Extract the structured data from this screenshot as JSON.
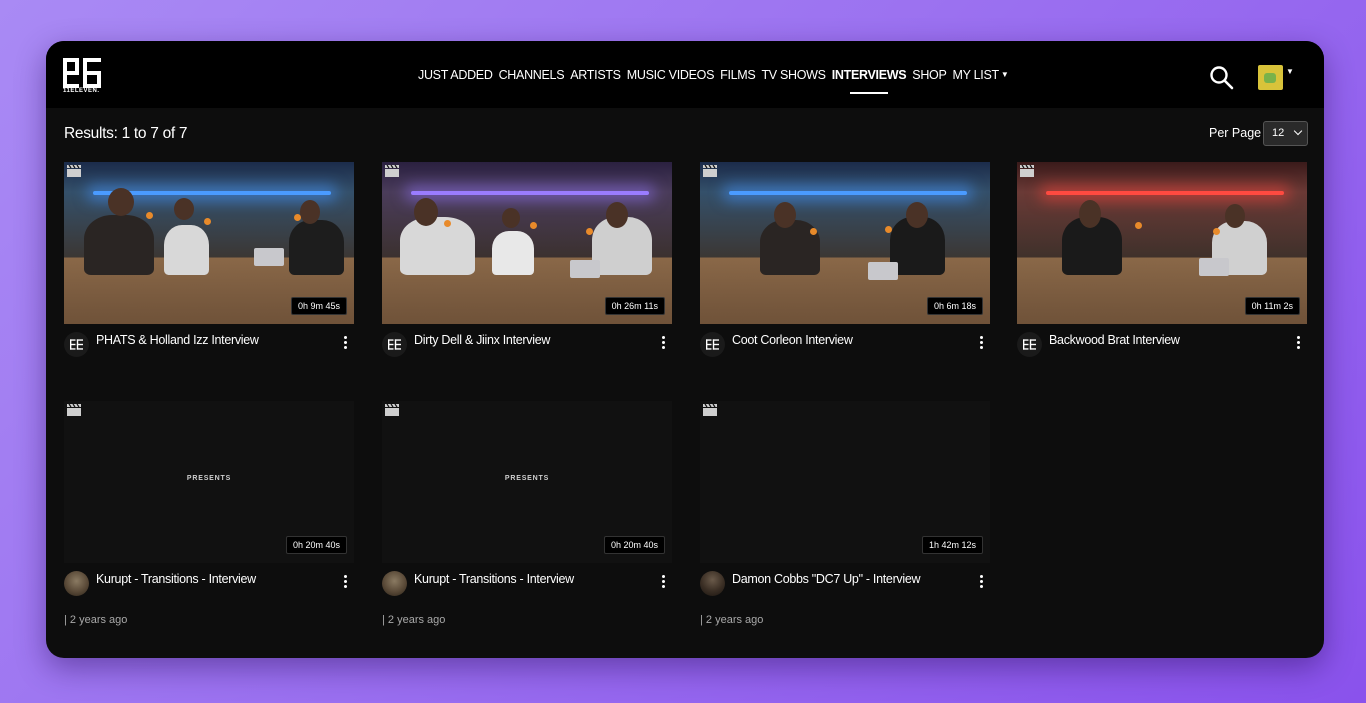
{
  "brand": {
    "logo_text": "11ELEVEN."
  },
  "nav": {
    "items": [
      {
        "label": "JUST ADDED"
      },
      {
        "label": "CHANNELS"
      },
      {
        "label": "ARTISTS"
      },
      {
        "label": "MUSIC VIDEOS"
      },
      {
        "label": "FILMS"
      },
      {
        "label": "TV SHOWS"
      },
      {
        "label": "INTERVIEWS",
        "active": true
      },
      {
        "label": "SHOP"
      },
      {
        "label": "MY LIST"
      }
    ]
  },
  "header_icons": {
    "search": "search-icon",
    "avatar": "avatar-icon"
  },
  "results": {
    "text": "Results: 1 to 7 of 7"
  },
  "per_page": {
    "label": "Per Page",
    "value": "12"
  },
  "videos": [
    {
      "title": "PHATS & Holland Izz Interview",
      "duration": "0h 9m 45s",
      "meta": ""
    },
    {
      "title": "Dirty Dell & Jiinx Interview",
      "duration": "0h 26m 11s",
      "meta": ""
    },
    {
      "title": "Coot Corleon Interview",
      "duration": "0h 6m 18s",
      "meta": ""
    },
    {
      "title": "Backwood Brat Interview",
      "duration": "0h 11m 2s",
      "meta": ""
    },
    {
      "title": "Kurupt - Transitions - Interview",
      "duration": "0h 20m 40s",
      "overlay": "PRESENTS",
      "meta": "| 2 years ago"
    },
    {
      "title": "Kurupt - Transitions - Interview",
      "duration": "0h 20m 40s",
      "overlay": "PRESENTS",
      "meta": "| 2 years ago"
    },
    {
      "title": "Damon Cobbs \"DC7 Up\" - Interview",
      "duration": "1h 42m 12s",
      "meta": "| 2 years ago"
    }
  ],
  "colors": {
    "accent": "#ffffff",
    "background": "#0d0d0d",
    "page_gradient": "#9a6ff0"
  }
}
